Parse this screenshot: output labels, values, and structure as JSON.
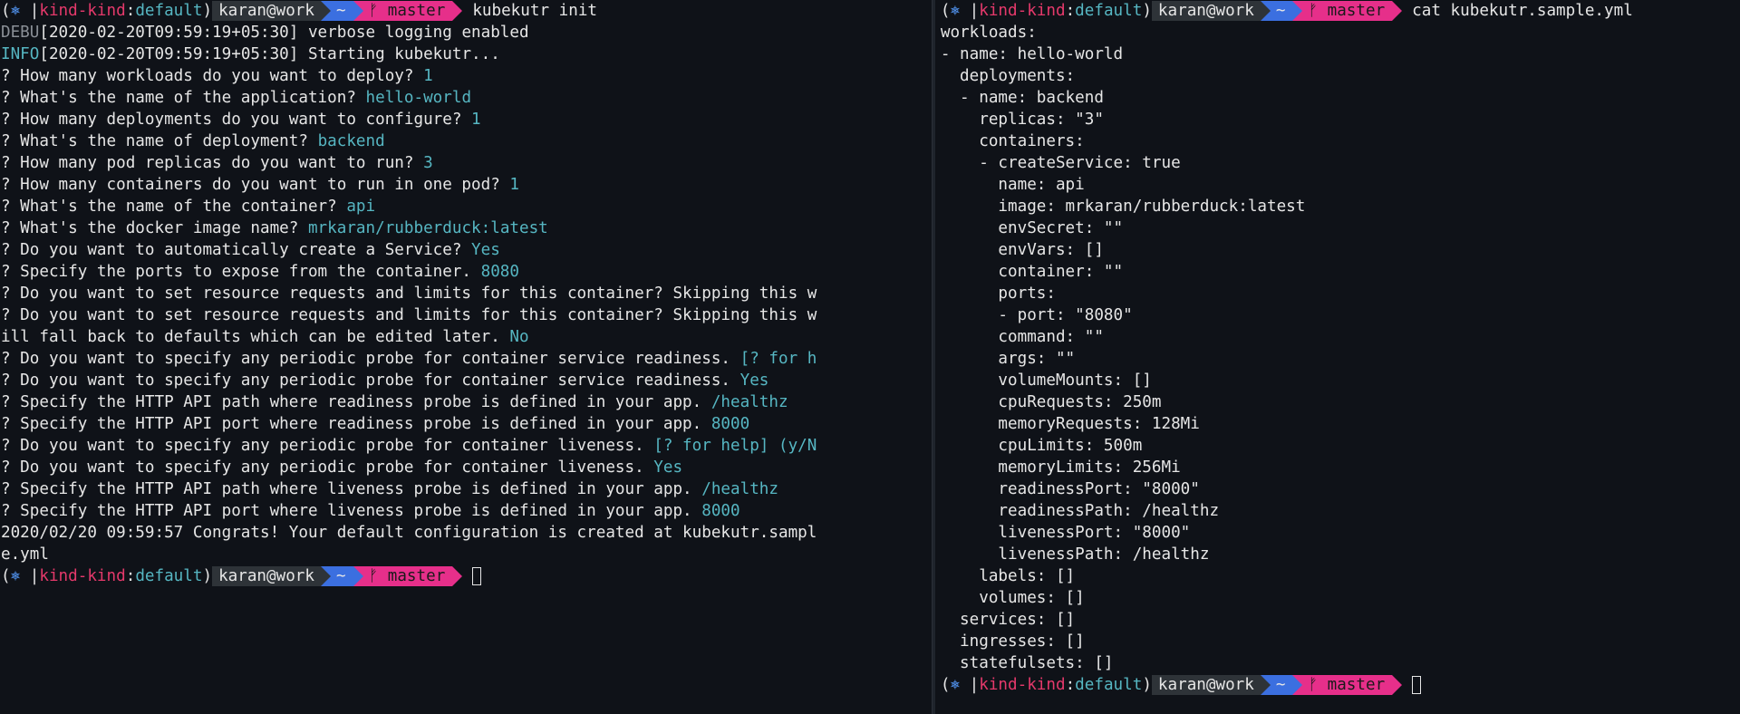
{
  "prompt": {
    "open": "(",
    "k8s_icon": "⎈",
    "bar": " |",
    "cluster": "kind-kind",
    "sep": ":",
    "namespace": "default",
    "close": ")",
    "user": "karan@work",
    "dir": "~",
    "git_icon": "ᚠ",
    "branch": "master"
  },
  "left": {
    "command": "kubekutr init",
    "logs": [
      {
        "level": "DEBU",
        "text": "[2020-02-20T09:59:19+05:30] verbose logging enabled"
      },
      {
        "level": "INFO",
        "text": "[2020-02-20T09:59:19+05:30] Starting kubekutr..."
      }
    ],
    "qa": [
      {
        "q": "? How many workloads do you want to deploy? ",
        "a": "1"
      },
      {
        "q": "? What's the name of the application? ",
        "a": "hello-world"
      },
      {
        "q": "? How many deployments do you want to configure? ",
        "a": "1"
      },
      {
        "q": "? What's the name of deployment? ",
        "a": "backend"
      },
      {
        "q": "? How many pod replicas do you want to run? ",
        "a": "3"
      },
      {
        "q": "? How many containers do you want to run in one pod? ",
        "a": "1"
      },
      {
        "q": "? What's the name of the container? ",
        "a": "api"
      },
      {
        "q": "? What's the docker image name? ",
        "a": "mrkaran/rubberduck:latest"
      },
      {
        "q": "? Do you want to automatically create a Service? ",
        "a": "Yes"
      },
      {
        "q": "? Specify the ports to expose from the container. ",
        "a": "8080"
      },
      {
        "q": "? Do you want to set resource requests and limits for this container? Skipping this w",
        "a": ""
      },
      {
        "q": "? Do you want to set resource requests and limits for this container? Skipping this w",
        "a": ""
      },
      {
        "q": "ill fall back to defaults which can be edited later. ",
        "a": "No"
      },
      {
        "q": "? Do you want to specify any periodic probe for container service readiness. ",
        "a": "[? for h"
      },
      {
        "q": "? Do you want to specify any periodic probe for container service readiness. ",
        "a": "Yes"
      },
      {
        "q": "? Specify the HTTP API path where readiness probe is defined in your app. ",
        "a": "/healthz"
      },
      {
        "q": "? Specify the HTTP API port where readiness probe is defined in your app. ",
        "a": "8000"
      },
      {
        "q": "? Do you want to specify any periodic probe for container liveness. ",
        "a": "[? for help] (y/N"
      },
      {
        "q": "? Do you want to specify any periodic probe for container liveness. ",
        "a": "Yes"
      },
      {
        "q": "? Specify the HTTP API path where liveness probe is defined in your app. ",
        "a": "/healthz"
      },
      {
        "q": "? Specify the HTTP API port where liveness probe is defined in your app. ",
        "a": "8000"
      }
    ],
    "result": [
      "2020/02/20 09:59:57 Congrats! Your default configuration is created at kubekutr.sampl",
      "e.yml"
    ]
  },
  "right": {
    "command": "cat kubekutr.sample.yml",
    "yaml": [
      "workloads:",
      "- name: hello-world",
      "  deployments:",
      "  - name: backend",
      "    replicas: \"3\"",
      "    containers:",
      "    - createService: true",
      "      name: api",
      "      image: mrkaran/rubberduck:latest",
      "      envSecret: \"\"",
      "      envVars: []",
      "      container: \"\"",
      "      ports:",
      "      - port: \"8080\"",
      "      command: \"\"",
      "      args: \"\"",
      "      volumeMounts: []",
      "      cpuRequests: 250m",
      "      memoryRequests: 128Mi",
      "      cpuLimits: 500m",
      "      memoryLimits: 256Mi",
      "      readinessPort: \"8000\"",
      "      readinessPath: /healthz",
      "      livenessPort: \"8000\"",
      "      livenessPath: /healthz",
      "    labels: []",
      "    volumes: []",
      "  services: []",
      "  ingresses: []",
      "  statefulsets: []"
    ]
  }
}
